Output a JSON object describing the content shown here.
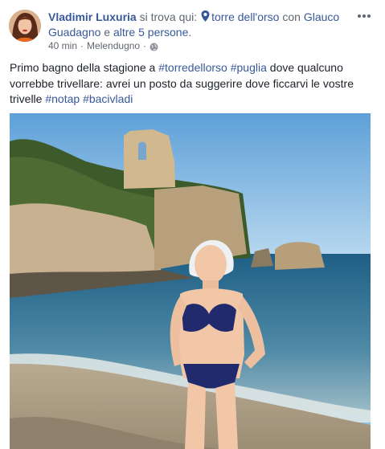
{
  "post": {
    "author": "Vladimir Luxuria",
    "checkin_prefix": "si trova qui:",
    "place": "torre dell'orso",
    "with_prefix": "con",
    "tagged_person": "Glauco Guadagno",
    "and_text": "e",
    "others": "altre 5 persone",
    "period": ".",
    "time": "40 min",
    "separator": "·",
    "location": "Melendugno",
    "privacy_icon": "globe-icon",
    "more_icon": "ellipsis-icon",
    "text": {
      "part1": "Primo bagno della stagione a ",
      "tag1": "#torredellorso",
      "space1": " ",
      "tag2": "#puglia",
      "part2": " dove qualcuno vorrebbe trivellare: avrei un posto da suggerire dove ficcarvi le vostre trivelle ",
      "tag3": "#notap",
      "space2": " ",
      "tag4": "#bacivladi"
    }
  },
  "colors": {
    "link": "#385898",
    "text": "#1d2129",
    "muted": "#606770"
  }
}
